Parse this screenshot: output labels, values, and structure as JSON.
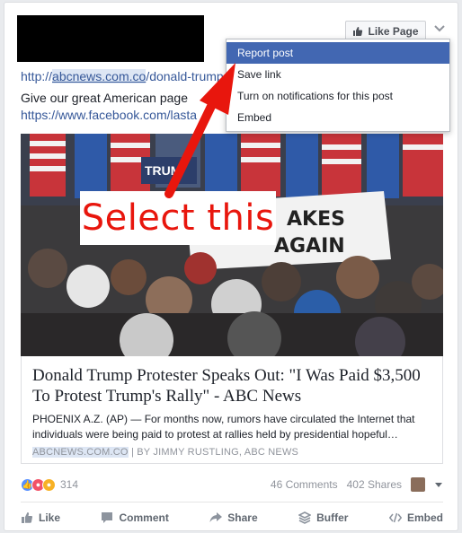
{
  "post": {
    "link_prefix": "http://",
    "link_domain": "abcnews.com.co",
    "link_suffix": "/donald-trump",
    "text": "Give our great American page",
    "link2": "https://www.facebook.com/lasta"
  },
  "header": {
    "like_page_label": "Like Page"
  },
  "menu": {
    "items": [
      {
        "label": "Report post"
      },
      {
        "label": "Save link"
      },
      {
        "label": "Turn on notifications for this post"
      },
      {
        "label": "Embed"
      }
    ]
  },
  "annotation": {
    "text": "Select this",
    "color": "#e8160d"
  },
  "preview": {
    "title": "Donald Trump Protester Speaks Out: \"I Was Paid $3,500 To Protest Trump's Rally\" - ABC News",
    "description": "PHOENIX A.Z. (AP) — For months now, rumors have circulated the Internet that individuals were being paid to protest at rallies held by presidential hopeful…",
    "source_domain": "ABCNEWS.COM.CO",
    "source_byline": " | BY JIMMY RUSTLING, ABC NEWS"
  },
  "photo": {
    "sign_text_1": "AKES",
    "sign_text_2": "AGAIN",
    "podium_text": "TRUM"
  },
  "stats": {
    "reaction_count": "314",
    "comments": "46 Comments",
    "shares": "402 Shares"
  },
  "actions": {
    "like": "Like",
    "comment": "Comment",
    "share": "Share",
    "buffer": "Buffer",
    "embed": "Embed"
  },
  "colors": {
    "link": "#365899",
    "menu_active": "#4267b2",
    "annotation": "#e8160d"
  }
}
